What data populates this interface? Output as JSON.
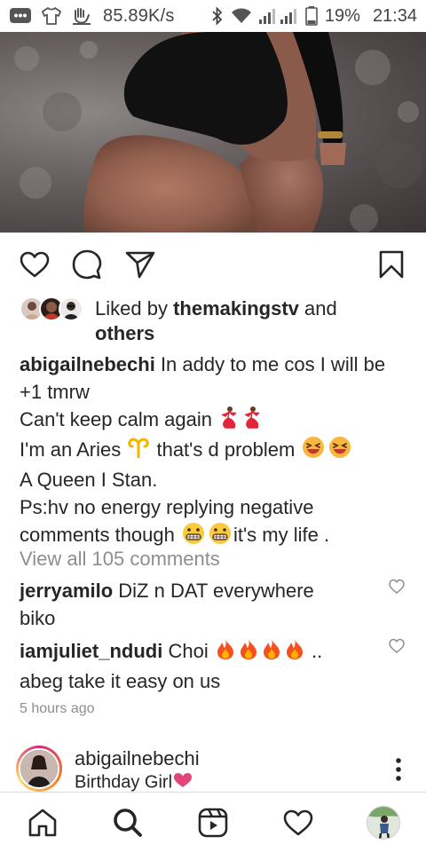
{
  "status_bar": {
    "net_speed": "85.89K/s",
    "battery": "19%",
    "time": "21:34"
  },
  "actions": {
    "like_icon": "heart-outline-icon",
    "comment_icon": "comment-icon",
    "share_icon": "send-icon",
    "save_icon": "bookmark-icon"
  },
  "likes": {
    "prefix": "Liked by ",
    "user": "themakingstv",
    "middle": " and",
    "others": "others"
  },
  "caption": {
    "user": "abigailnebechi",
    "line1": " In addy to me cos I will be",
    "line2": "+1 tmrw",
    "line3": "Can't keep calm again ",
    "line4a": "I'm an Aries ",
    "line4b": " that's d problem ",
    "line5": "A Queen I Stan.",
    "line6": "Ps:hv no energy replying negative",
    "line7a": "comments though ",
    "line7b": "it's my life ."
  },
  "view_all_comments": "View all 105 comments",
  "comments": [
    {
      "user": "jerryamilo",
      "text": " DiZ n DAT everywhere",
      "text2": "biko"
    },
    {
      "user": "iamjuliet_ndudi",
      "text": " Choi ",
      "text_end": " ..",
      "text2": "abeg take it easy on us"
    }
  ],
  "timestamp": "5 hours ago",
  "next_post": {
    "user": "abigailnebechi",
    "subtitle": "Birthday Girl"
  },
  "colors": {
    "primary_text": "#262626",
    "secondary_text": "#8e8e8e",
    "story_ring": "#d62976",
    "heart_emoji": "#e0457b"
  }
}
